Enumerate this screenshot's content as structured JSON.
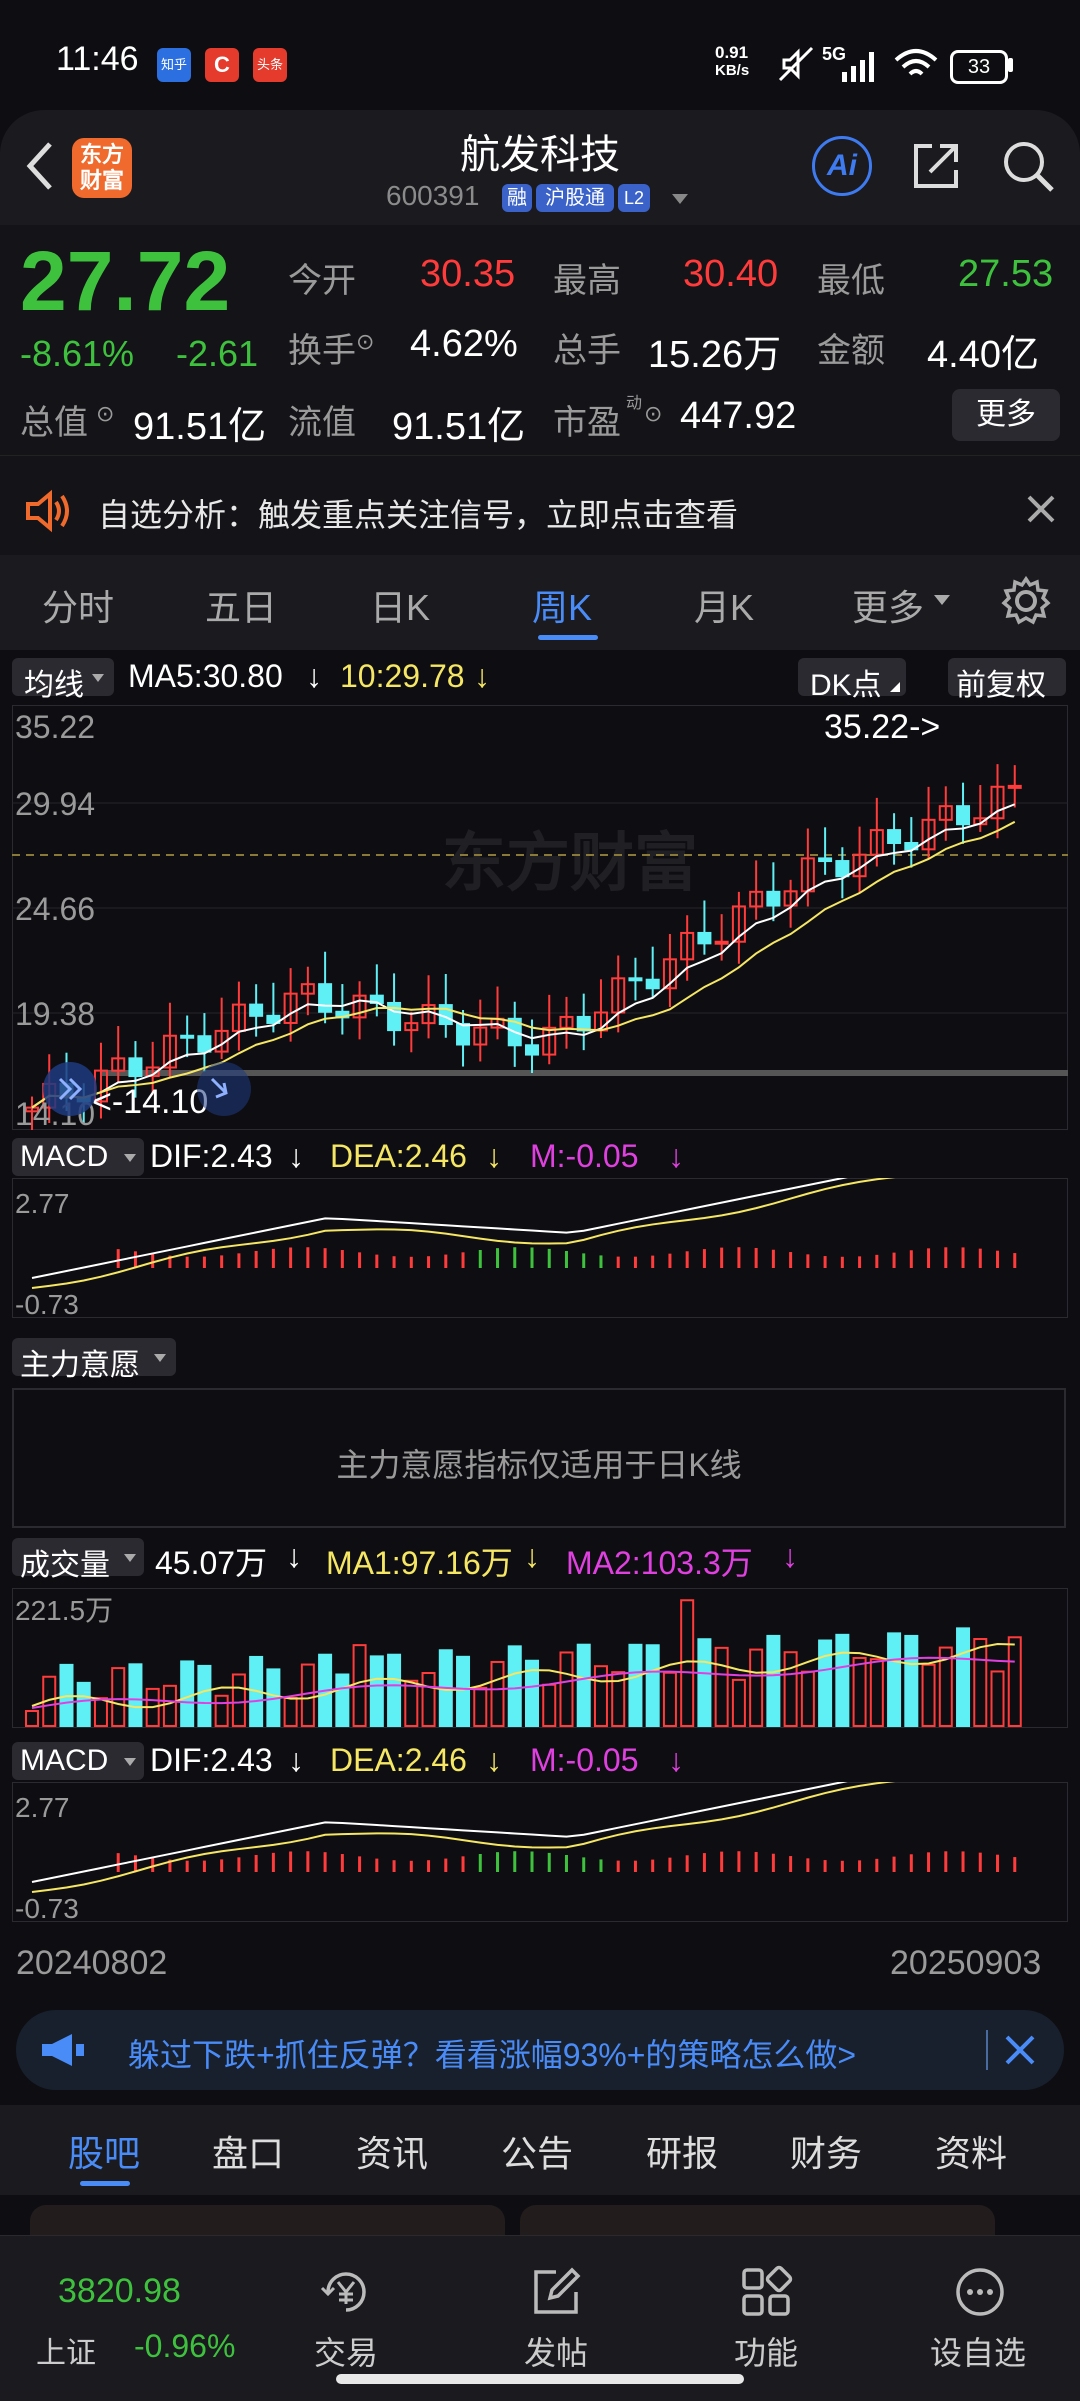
{
  "status": {
    "time": "11:46",
    "app_icons": [
      "知乎",
      "C",
      "头条"
    ],
    "speed_value": "0.91",
    "speed_unit": "KB/s",
    "network": "5G",
    "battery": "33"
  },
  "header": {
    "logo_text": "东方财富",
    "title": "航发科技",
    "code": "600391",
    "tags": [
      "融",
      "沪股通",
      "L2"
    ],
    "ai_label": "Ai"
  },
  "quote": {
    "price": "27.72",
    "change_pct": "-8.61%",
    "change": "-2.61",
    "open_label": "今开",
    "open": "30.35",
    "high_label": "最高",
    "high": "30.40",
    "low_label": "最低",
    "low": "27.53",
    "turnover_label": "换手",
    "turnover": "4.62%",
    "volume_label": "总手",
    "volume": "15.26万",
    "amount_label": "金额",
    "amount": "4.40亿",
    "mktcap_label": "总值",
    "mktcap": "91.51亿",
    "float_label": "流值",
    "float": "91.51亿",
    "pe_label": "市盈",
    "pe_sup": "动",
    "pe": "447.92",
    "more_button": "更多"
  },
  "notice": {
    "text": "自选分析：触发重点关注信号，立即点击查看"
  },
  "tabs": {
    "items": [
      "分时",
      "五日",
      "日K",
      "周K",
      "月K",
      "更多"
    ],
    "active": "周K"
  },
  "kchart": {
    "ma_selector": "均线",
    "ma5_label": "MA5:30.80",
    "ma10_label": "10:29.78",
    "dk_button": "DK点",
    "fq_button": "前复权",
    "y_ticks": [
      "35.22",
      "29.94",
      "24.66",
      "19.38",
      "14.10"
    ],
    "max_marker": "35.22->",
    "min_marker": "<-14.10",
    "watermark": "东方财富",
    "colors": {
      "up": "#ff3b3b",
      "down": "#5ff0f5",
      "ma5": "#ffffff",
      "ma10": "#f5e663"
    }
  },
  "macd1": {
    "selector": "MACD",
    "dif": "DIF:2.43",
    "dea": "DEA:2.46",
    "m": "M:-0.05",
    "y_top": "2.77",
    "y_bottom": "-0.73"
  },
  "mainforce": {
    "selector": "主力意愿",
    "message": "主力意愿指标仅适用于日K线"
  },
  "volume": {
    "selector": "成交量",
    "value": "45.07万",
    "ma1": "MA1:97.16万",
    "ma2": "MA2:103.3万",
    "y_top": "221.5万"
  },
  "macd2": {
    "selector": "MACD",
    "dif": "DIF:2.43",
    "dea": "DEA:2.46",
    "m": "M:-0.05",
    "y_top": "2.77",
    "y_bottom": "-0.73"
  },
  "dates": {
    "start": "20240802",
    "end": "20250903"
  },
  "ad": {
    "text": "躲过下跌+抓住反弹？看看涨幅93%+的策略怎么做>"
  },
  "bottom_tabs": {
    "items": [
      "股吧",
      "盘口",
      "资讯",
      "公告",
      "研报",
      "财务",
      "资料"
    ],
    "active": "股吧"
  },
  "index": {
    "value": "3820.98",
    "name": "上证",
    "change": "-0.96%"
  },
  "nav": [
    {
      "label": "交易",
      "icon": "yen-circle-icon"
    },
    {
      "label": "发帖",
      "icon": "edit-icon"
    },
    {
      "label": "功能",
      "icon": "grid-icon"
    },
    {
      "label": "设自选",
      "icon": "more-icon"
    }
  ]
}
